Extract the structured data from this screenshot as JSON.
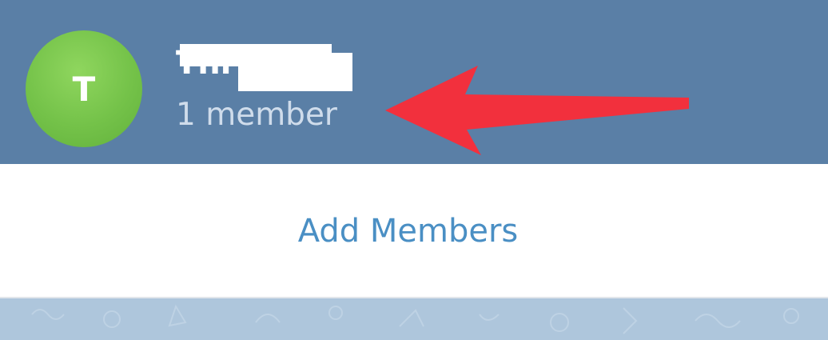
{
  "chat_header": {
    "avatar_letter": "T",
    "title": "Thr",
    "title_redacted": true,
    "member_count": "1 member",
    "background_color": "#5a7fa6",
    "avatar_color": "#74c249"
  },
  "actions": {
    "add_members_label": "Add Members",
    "link_color": "#4a8fc4"
  },
  "annotation": {
    "icon": "red-arrow-icon",
    "color": "#f2303d"
  }
}
